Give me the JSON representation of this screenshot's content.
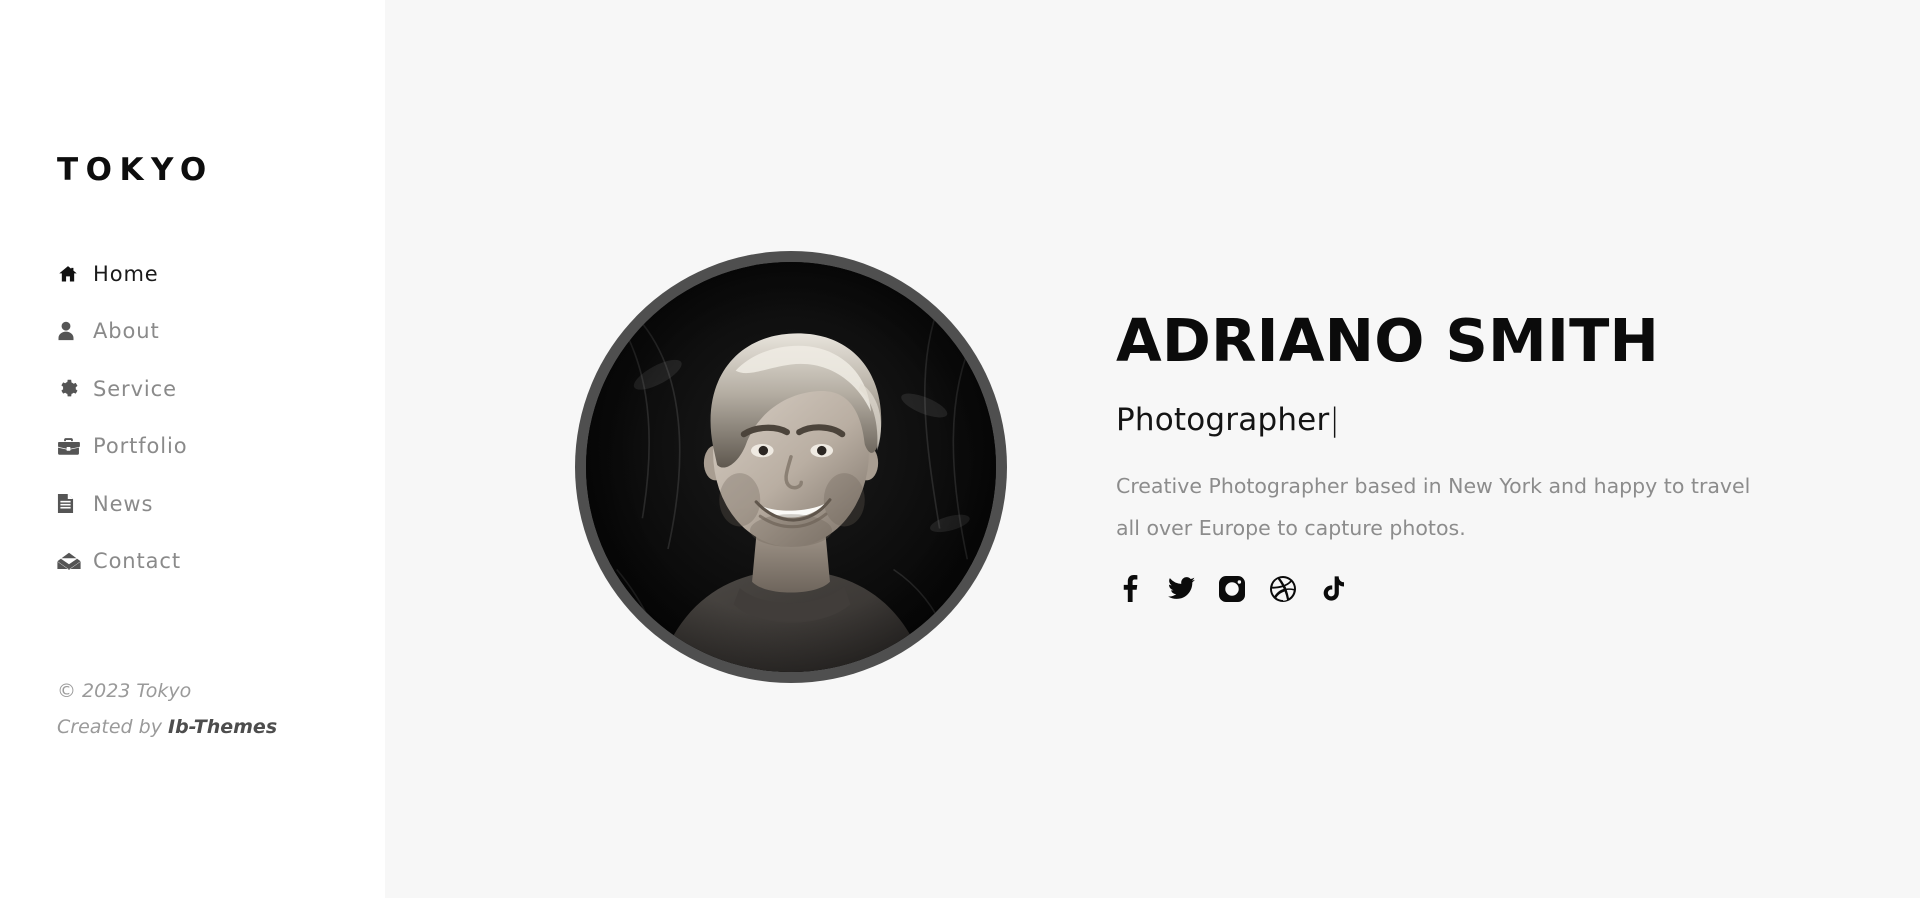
{
  "sidebar": {
    "brand": "TOKYO",
    "nav_items": [
      {
        "label": "Home",
        "icon": "home-icon",
        "active": true
      },
      {
        "label": "About",
        "icon": "user-icon",
        "active": false
      },
      {
        "label": "Service",
        "icon": "gear-icon",
        "active": false
      },
      {
        "label": "Portfolio",
        "icon": "briefcase-icon",
        "active": false
      },
      {
        "label": "News",
        "icon": "document-icon",
        "active": false
      },
      {
        "label": "Contact",
        "icon": "envelope-icon",
        "active": false
      }
    ],
    "footer": {
      "copyright": "© 2023 Tokyo",
      "created_by_prefix": "Created by ",
      "created_by_name": "Ib-Themes"
    }
  },
  "hero": {
    "name": "ADRIANO SMITH",
    "role": "Photographer",
    "role_caret": "|",
    "description": "Creative Photographer based in New York and happy to travel all over Europe to capture photos.",
    "portrait_alt": "portrait-photo",
    "socials": [
      {
        "name": "facebook-icon"
      },
      {
        "name": "twitter-icon"
      },
      {
        "name": "instagram-icon"
      },
      {
        "name": "dribbble-icon"
      },
      {
        "name": "tiktok-icon"
      }
    ]
  },
  "colors": {
    "sidebar_bg": "#ffffff",
    "main_bg": "#f7f7f7",
    "text_dark": "#0b0b0b",
    "text_muted": "#8c8c8c",
    "ring": "#4f4f4f"
  }
}
